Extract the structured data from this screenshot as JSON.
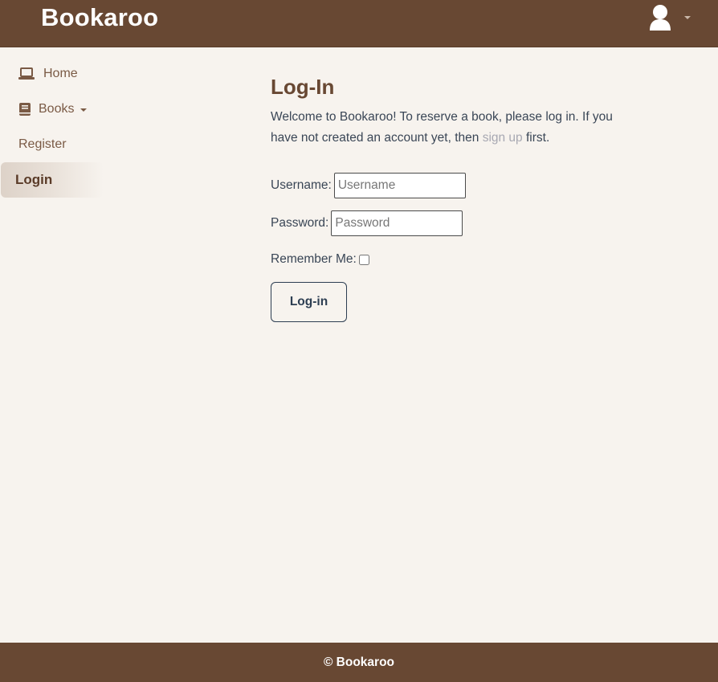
{
  "header": {
    "brand": "Bookaroo",
    "user_icon": "user-avatar-icon",
    "caret_icon": "chevron-down-icon"
  },
  "sidebar": {
    "items": [
      {
        "label": "Home",
        "icon": "laptop-icon"
      },
      {
        "label": "Books",
        "icon": "book-icon",
        "has_dropdown": true
      },
      {
        "label": "Register"
      },
      {
        "label": "Login",
        "active": true
      }
    ]
  },
  "main": {
    "title": "Log-In",
    "intro_before_link": "Welcome to Bookaroo! To reserve a book, please log in. If you have not created an account yet, then ",
    "intro_link": "sign up",
    "intro_after_link": " first.",
    "form": {
      "username_label": "Username:",
      "username_placeholder": "Username",
      "username_value": "",
      "password_label": "Password:",
      "password_placeholder": "Password",
      "password_value": "",
      "remember_label": "Remember Me:",
      "remember_checked": false,
      "submit_label": "Log-in"
    }
  },
  "footer": {
    "text": "© Bookaroo"
  },
  "colors": {
    "brand_brown": "#684833",
    "page_bg": "#f7f3ee",
    "text_slate": "#3a4656",
    "link_gray": "#a7a8b2",
    "button_border": "#2d3e52"
  }
}
